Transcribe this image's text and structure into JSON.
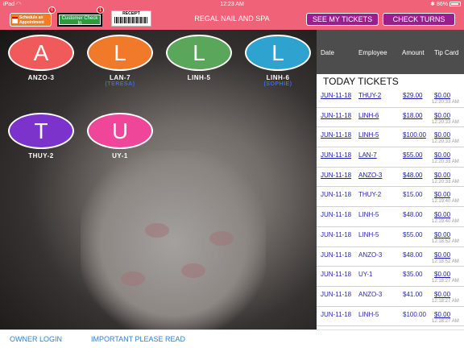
{
  "status_bar": {
    "device": "iPad",
    "wifi_icon": "wifi-icon",
    "time": "12:23 AM",
    "battery": "86%",
    "bluetooth_icon": "bluetooth-icon"
  },
  "header": {
    "schedule_button": "Schedule an Appointment",
    "schedule_badge": "6",
    "checkin_button": "Customer Check In",
    "checkin_badge": "1",
    "receipt_label": "RECEIPT",
    "title": "REGAL NAIL AND SPA",
    "my_tickets_button": "SEE MY TICKETS",
    "check_turns_button": "CHECK TURNS"
  },
  "employees": [
    {
      "letter": "A",
      "name": "ANZO-3",
      "sub": "",
      "color": "#f05a5a"
    },
    {
      "letter": "L",
      "name": "LAN-7",
      "sub": "(TERESA)",
      "color": "#f07a2a"
    },
    {
      "letter": "L",
      "name": "LINH-5",
      "sub": "",
      "color": "#5aa65a"
    },
    {
      "letter": "L",
      "name": "LINH-6",
      "sub": "(SOPHIE)",
      "color": "#2ea3cf"
    },
    {
      "letter": "T",
      "name": "THUY-2",
      "sub": "",
      "color": "#7b33cc"
    },
    {
      "letter": "U",
      "name": "UY-1",
      "sub": "",
      "color": "#f0469a"
    }
  ],
  "tickets_panel": {
    "columns": [
      "Date",
      "Employee",
      "Amount",
      "Tip Card"
    ],
    "title": "TODAY TICKETS",
    "rows": [
      {
        "date": "JUN-11-18",
        "employee": "THUY-2",
        "amount": "$29.00",
        "tip": "$0.00",
        "time": "12:20:33 AM",
        "linked": true
      },
      {
        "date": "JUN-11-18",
        "employee": "LINH-6",
        "amount": "$18.00",
        "tip": "$0.00",
        "time": "12:20:33 AM",
        "linked": true
      },
      {
        "date": "JUN-11-18",
        "employee": "LINH-5",
        "amount": "$100.00",
        "tip": "$0.00",
        "time": "12:20:33 AM",
        "linked": true
      },
      {
        "date": "JUN-11-18",
        "employee": "LAN-7",
        "amount": "$55.00",
        "tip": "$0.00",
        "time": "12:20:33 AM",
        "linked": true
      },
      {
        "date": "JUN-11-18",
        "employee": "ANZO-3",
        "amount": "$48.00",
        "tip": "$0.00",
        "time": "12:20:33 AM",
        "linked": true
      },
      {
        "date": "JUN-11-18",
        "employee": "THUY-2",
        "amount": "$15.00",
        "tip": "$0.00",
        "time": "12:19:40 AM",
        "linked": false
      },
      {
        "date": "JUN-11-18",
        "employee": "LINH-5",
        "amount": "$48.00",
        "tip": "$0.00",
        "time": "12:19:40 AM",
        "linked": false
      },
      {
        "date": "JUN-11-18",
        "employee": "LINH-5",
        "amount": "$55.00",
        "tip": "$0.00",
        "time": "12:18:52 AM",
        "linked": false
      },
      {
        "date": "JUN-11-18",
        "employee": "ANZO-3",
        "amount": "$48.00",
        "tip": "$0.00",
        "time": "12:18:52 AM",
        "linked": false
      },
      {
        "date": "JUN-11-18",
        "employee": "UY-1",
        "amount": "$35.00",
        "tip": "$0.00",
        "time": "12:18:27 AM",
        "linked": false
      },
      {
        "date": "JUN-11-18",
        "employee": "ANZO-3",
        "amount": "$41.00",
        "tip": "$0.00",
        "time": "12:18:27 AM",
        "linked": false
      },
      {
        "date": "JUN-11-18",
        "employee": "LINH-5",
        "amount": "$100.00",
        "tip": "$0.00",
        "time": "12:18:27 AM",
        "linked": false
      }
    ]
  },
  "footer": {
    "owner_login": "OWNER LOGIN",
    "important": "IMPORTANT PLEASE READ"
  }
}
